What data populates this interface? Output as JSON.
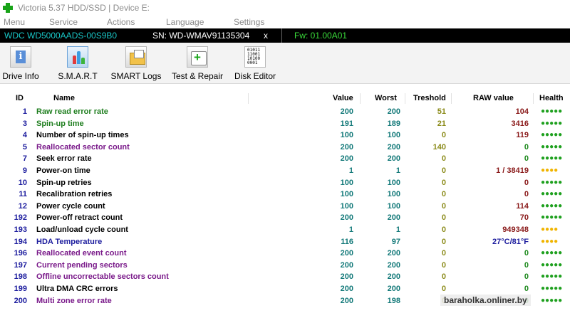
{
  "window": {
    "title": "Victoria 5.37 HDD/SSD | Device E:"
  },
  "menu": [
    "Menu",
    "Service",
    "Actions",
    "Language",
    "Settings"
  ],
  "device": {
    "model": "WDC WD5000AADS-00S9B0",
    "serial": "SN: WD-WMAV91135304",
    "close": "x",
    "firmware": "Fw: 01.00A01"
  },
  "toolbar": [
    {
      "label": "Drive Info",
      "icon": "info-icon"
    },
    {
      "label": "S.M.A.R.T",
      "icon": "smart-chart-icon"
    },
    {
      "label": "SMART Logs",
      "icon": "folder-logs-icon"
    },
    {
      "label": "Test & Repair",
      "icon": "first-aid-icon"
    },
    {
      "label": "Disk Editor",
      "icon": "hex-editor-icon"
    }
  ],
  "table": {
    "headers": {
      "id": "ID",
      "name": "Name",
      "value": "Value",
      "worst": "Worst",
      "threshold": "Treshold",
      "raw": "RAW value",
      "health": "Health"
    },
    "rows": [
      {
        "id": "1",
        "name": "Raw read error rate",
        "value": "200",
        "worst": "200",
        "threshold": "51",
        "raw": "104",
        "health": "●●●●●",
        "name_color": "#1e7e1e",
        "health_color": "#1ea01e",
        "raw_color": "#8a1a1a",
        "thr_color": "#8a8a18"
      },
      {
        "id": "3",
        "name": "Spin-up time",
        "value": "191",
        "worst": "189",
        "threshold": "21",
        "raw": "3416",
        "health": "●●●●●",
        "name_color": "#1e7e1e",
        "health_color": "#1ea01e",
        "raw_color": "#8a1a1a",
        "thr_color": "#8a8a18"
      },
      {
        "id": "4",
        "name": "Number of spin-up times",
        "value": "100",
        "worst": "100",
        "threshold": "0",
        "raw": "119",
        "health": "●●●●●",
        "name_color": "#000000",
        "health_color": "#1ea01e",
        "raw_color": "#8a1a1a",
        "thr_color": "#8a8a18"
      },
      {
        "id": "5",
        "name": "Reallocated sector count",
        "value": "200",
        "worst": "200",
        "threshold": "140",
        "raw": "0",
        "health": "●●●●●",
        "name_color": "#7a1a8a",
        "health_color": "#1ea01e",
        "raw_color": "#1e8a1e",
        "thr_color": "#8a8a18"
      },
      {
        "id": "7",
        "name": "Seek error rate",
        "value": "200",
        "worst": "200",
        "threshold": "0",
        "raw": "0",
        "health": "●●●●●",
        "name_color": "#000000",
        "health_color": "#1ea01e",
        "raw_color": "#1e8a1e",
        "thr_color": "#8a8a18"
      },
      {
        "id": "9",
        "name": "Power-on time",
        "value": "1",
        "worst": "1",
        "threshold": "0",
        "raw": "1 / 38419",
        "health": "●●●●",
        "name_color": "#000000",
        "health_color": "#f0b400",
        "raw_color": "#8a1a1a",
        "thr_color": "#8a8a18"
      },
      {
        "id": "10",
        "name": "Spin-up retries",
        "value": "100",
        "worst": "100",
        "threshold": "0",
        "raw": "0",
        "health": "●●●●●",
        "name_color": "#000000",
        "health_color": "#1ea01e",
        "raw_color": "#8a1a1a",
        "thr_color": "#8a8a18"
      },
      {
        "id": "11",
        "name": "Recalibration retries",
        "value": "100",
        "worst": "100",
        "threshold": "0",
        "raw": "0",
        "health": "●●●●●",
        "name_color": "#000000",
        "health_color": "#1ea01e",
        "raw_color": "#8a1a1a",
        "thr_color": "#8a8a18"
      },
      {
        "id": "12",
        "name": "Power cycle count",
        "value": "100",
        "worst": "100",
        "threshold": "0",
        "raw": "114",
        "health": "●●●●●",
        "name_color": "#000000",
        "health_color": "#1ea01e",
        "raw_color": "#8a1a1a",
        "thr_color": "#8a8a18"
      },
      {
        "id": "192",
        "name": "Power-off retract count",
        "value": "200",
        "worst": "200",
        "threshold": "0",
        "raw": "70",
        "health": "●●●●●",
        "name_color": "#000000",
        "health_color": "#1ea01e",
        "raw_color": "#8a1a1a",
        "thr_color": "#8a8a18"
      },
      {
        "id": "193",
        "name": "Load/unload cycle count",
        "value": "1",
        "worst": "1",
        "threshold": "0",
        "raw": "949348",
        "health": "●●●●",
        "name_color": "#000000",
        "health_color": "#f0b400",
        "raw_color": "#8a1a1a",
        "thr_color": "#8a8a18"
      },
      {
        "id": "194",
        "name": "HDA Temperature",
        "value": "116",
        "worst": "97",
        "threshold": "0",
        "raw": "27°C/81°F",
        "health": "●●●●",
        "name_color": "#1c1c9e",
        "health_color": "#f0b400",
        "raw_color": "#1c1c9e",
        "thr_color": "#8a8a18"
      },
      {
        "id": "196",
        "name": "Reallocated event count",
        "value": "200",
        "worst": "200",
        "threshold": "0",
        "raw": "0",
        "health": "●●●●●",
        "name_color": "#7a1a8a",
        "health_color": "#1ea01e",
        "raw_color": "#1e8a1e",
        "thr_color": "#8a8a18"
      },
      {
        "id": "197",
        "name": "Current pending sectors",
        "value": "200",
        "worst": "200",
        "threshold": "0",
        "raw": "0",
        "health": "●●●●●",
        "name_color": "#7a1a8a",
        "health_color": "#1ea01e",
        "raw_color": "#1e8a1e",
        "thr_color": "#8a8a18"
      },
      {
        "id": "198",
        "name": "Offline uncorrectable sectors count",
        "value": "200",
        "worst": "200",
        "threshold": "0",
        "raw": "0",
        "health": "●●●●●",
        "name_color": "#7a1a8a",
        "health_color": "#1ea01e",
        "raw_color": "#1e8a1e",
        "thr_color": "#8a8a18"
      },
      {
        "id": "199",
        "name": "Ultra DMA CRC errors",
        "value": "200",
        "worst": "200",
        "threshold": "0",
        "raw": "0",
        "health": "●●●●●",
        "name_color": "#000000",
        "health_color": "#1ea01e",
        "raw_color": "#1e8a1e",
        "thr_color": "#8a8a18"
      },
      {
        "id": "200",
        "name": "Multi zone error rate",
        "value": "200",
        "worst": "198",
        "threshold": "0",
        "raw": "0",
        "health": "●●●●●",
        "name_color": "#7a1a8a",
        "health_color": "#1ea01e",
        "raw_color": "#1e8a1e",
        "thr_color": "#8a8a18"
      }
    ]
  },
  "watermark": "baraholka.onliner.by"
}
